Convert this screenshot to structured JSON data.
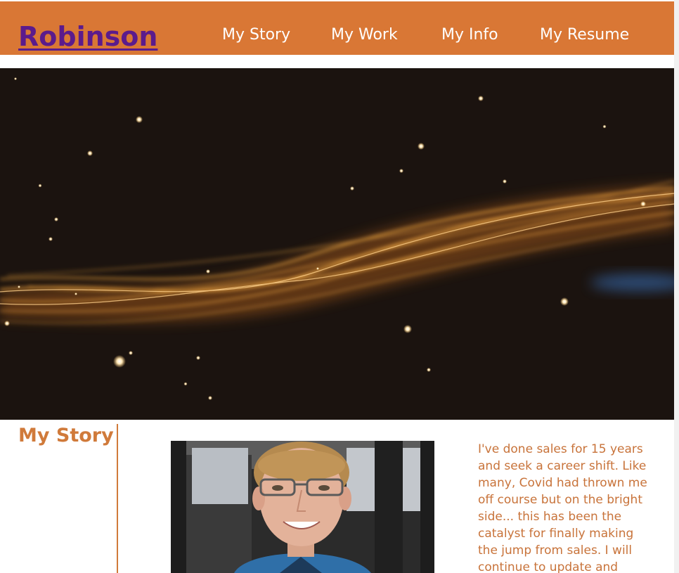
{
  "header": {
    "brand": "Robinson",
    "nav": [
      {
        "label": "My Story"
      },
      {
        "label": "My Work"
      },
      {
        "label": "My Info"
      },
      {
        "label": "My Resume"
      }
    ]
  },
  "colors": {
    "header_bg": "#d97735",
    "brand": "#5b1b8c",
    "accent_text": "#d07a3a"
  },
  "story": {
    "title": "My Story",
    "lines": [
      "I've done sales for 15 years",
      "and seek a career shift. Like",
      "many, Covid had thrown me",
      "off course but on the bright",
      "side... this has been the",
      "catalyst for finally making",
      "the jump from sales. I will",
      "continue to update and"
    ]
  }
}
